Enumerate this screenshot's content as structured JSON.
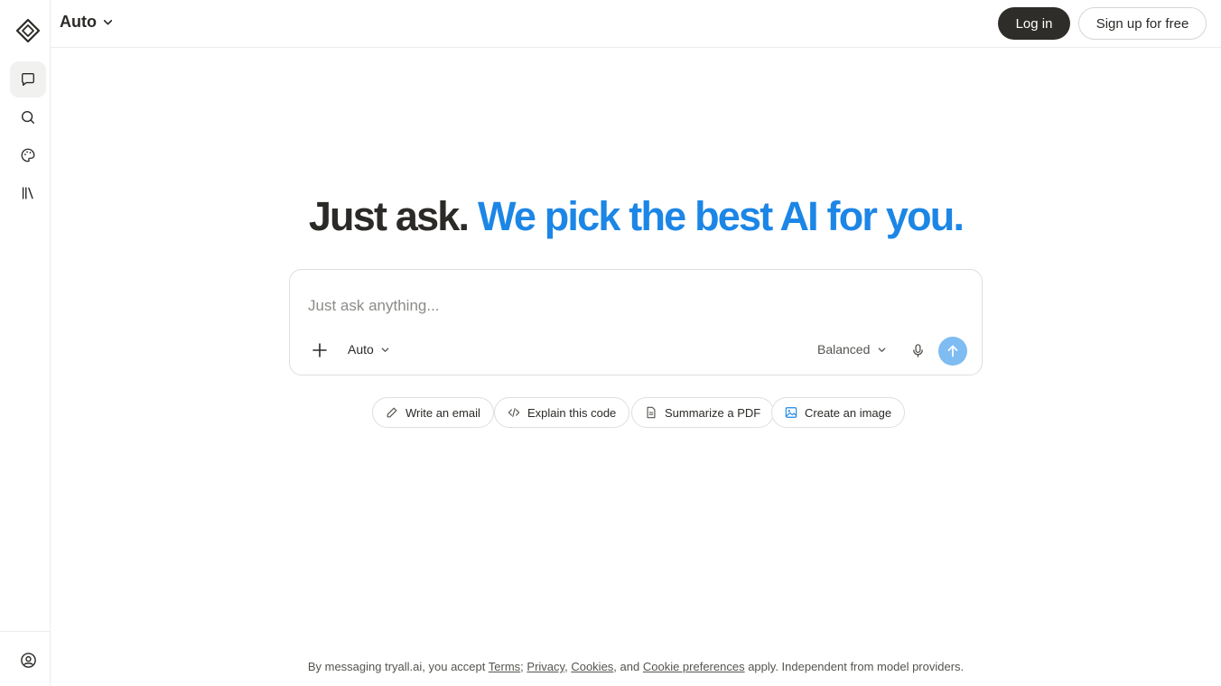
{
  "sidebar": {
    "logo_icon": "diamond-logo-icon",
    "items": [
      {
        "name": "chat",
        "icon": "chat-bubble-icon",
        "active": true
      },
      {
        "name": "search",
        "icon": "search-icon",
        "active": false
      },
      {
        "name": "palette",
        "icon": "palette-icon",
        "active": false
      },
      {
        "name": "library",
        "icon": "library-icon",
        "active": false
      }
    ],
    "profile_icon": "user-circle-icon"
  },
  "header": {
    "model_label": "Auto",
    "login_label": "Log in",
    "signup_label": "Sign up for free"
  },
  "hero": {
    "part1": "Just ask.",
    "part2": "We pick the best AI for you."
  },
  "composer": {
    "placeholder": "Just ask anything...",
    "model_label": "Auto",
    "mode_label": "Balanced"
  },
  "suggestions": [
    {
      "label": "Write an email",
      "icon": "pencil-icon"
    },
    {
      "label": "Explain this code",
      "icon": "code-icon"
    },
    {
      "label": "Summarize a PDF",
      "icon": "document-icon"
    },
    {
      "label": "Create an image",
      "icon": "image-icon"
    }
  ],
  "footer": {
    "prefix": "By messaging tryall.ai, you accept",
    "terms": "Terms",
    "sep1": ";",
    "privacy": "Privacy",
    "sep2": ",",
    "cookies": "Cookies",
    "sep3": ", and",
    "cookie_prefs": "Cookie preferences",
    "suffix": "apply. Independent from model providers."
  },
  "colors": {
    "accent_blue": "#1c86e6",
    "send_button": "#7ebcf2",
    "login_bg": "#2e2d2a",
    "text_dark": "#2b2a27"
  }
}
